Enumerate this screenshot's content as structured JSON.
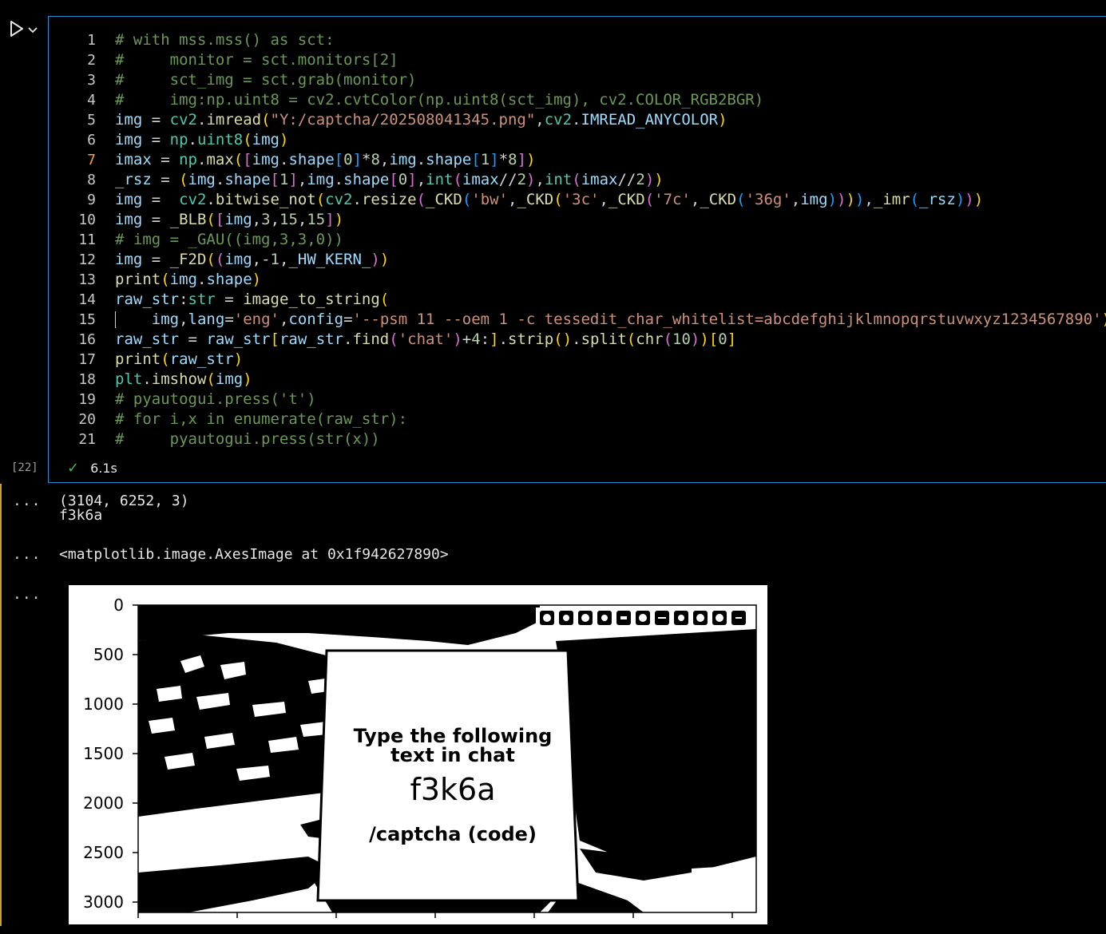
{
  "cell": {
    "exec_count": "[22]",
    "status_time": "6.1s",
    "icons": {
      "run": "play-icon",
      "run_menu": "chevron-down-icon",
      "status": "check-icon"
    }
  },
  "code_lines": [
    {
      "n": "1",
      "tokens": [
        [
          "cm",
          "# with mss.mss() as sct:"
        ]
      ]
    },
    {
      "n": "2",
      "tokens": [
        [
          "cm",
          "#     monitor = sct.monitors[2]"
        ]
      ]
    },
    {
      "n": "3",
      "tokens": [
        [
          "cm",
          "#     sct_img = sct.grab(monitor)"
        ]
      ]
    },
    {
      "n": "4",
      "tokens": [
        [
          "cm",
          "#     img:np.uint8 = cv2.cvtColor(np.uint8(sct_img), cv2.COLOR_RGB2BGR)"
        ]
      ]
    },
    {
      "n": "5",
      "tokens": [
        [
          "vr",
          "img"
        ],
        [
          "op",
          " = "
        ],
        [
          "bi",
          "cv2"
        ],
        [
          "op",
          "."
        ],
        [
          "fn",
          "imread"
        ],
        [
          "p1",
          "("
        ],
        [
          "st",
          "\"Y:/captcha/202508041345.png\""
        ],
        [
          "op",
          ","
        ],
        [
          "bi",
          "cv2"
        ],
        [
          "op",
          "."
        ],
        [
          "vr",
          "IMREAD_ANYCOLOR"
        ],
        [
          "p1",
          ")"
        ]
      ]
    },
    {
      "n": "6",
      "tokens": [
        [
          "vr",
          "img"
        ],
        [
          "op",
          " = "
        ],
        [
          "bi",
          "np"
        ],
        [
          "op",
          "."
        ],
        [
          "bi",
          "uint8"
        ],
        [
          "p1",
          "("
        ],
        [
          "vr",
          "img"
        ],
        [
          "p1",
          ")"
        ]
      ]
    },
    {
      "n": "7",
      "active": true,
      "tokens": [
        [
          "vr",
          "imax"
        ],
        [
          "op",
          " = "
        ],
        [
          "bi",
          "np"
        ],
        [
          "op",
          "."
        ],
        [
          "fn",
          "max"
        ],
        [
          "p1",
          "("
        ],
        [
          "p2",
          "["
        ],
        [
          "vr",
          "img"
        ],
        [
          "op",
          "."
        ],
        [
          "vr",
          "shape"
        ],
        [
          "p3",
          "["
        ],
        [
          "nm",
          "0"
        ],
        [
          "p3",
          "]"
        ],
        [
          "op",
          "*"
        ],
        [
          "nm",
          "8"
        ],
        [
          "op",
          ","
        ],
        [
          "vr",
          "img"
        ],
        [
          "op",
          "."
        ],
        [
          "vr",
          "shape"
        ],
        [
          "p3",
          "["
        ],
        [
          "nm",
          "1"
        ],
        [
          "p3",
          "]"
        ],
        [
          "op",
          "*"
        ],
        [
          "nm",
          "8"
        ],
        [
          "p2",
          "]"
        ],
        [
          "p1",
          ")"
        ]
      ]
    },
    {
      "n": "8",
      "tokens": [
        [
          "vr",
          "_rsz"
        ],
        [
          "op",
          " = "
        ],
        [
          "p1",
          "("
        ],
        [
          "vr",
          "img"
        ],
        [
          "op",
          "."
        ],
        [
          "vr",
          "shape"
        ],
        [
          "p2",
          "["
        ],
        [
          "nm",
          "1"
        ],
        [
          "p2",
          "]"
        ],
        [
          "op",
          ","
        ],
        [
          "vr",
          "img"
        ],
        [
          "op",
          "."
        ],
        [
          "vr",
          "shape"
        ],
        [
          "p2",
          "["
        ],
        [
          "nm",
          "0"
        ],
        [
          "p2",
          "]"
        ],
        [
          "op",
          ","
        ],
        [
          "bi",
          "int"
        ],
        [
          "p2",
          "("
        ],
        [
          "vr",
          "imax"
        ],
        [
          "op",
          "//"
        ],
        [
          "nm",
          "2"
        ],
        [
          "p2",
          ")"
        ],
        [
          "op",
          ","
        ],
        [
          "bi",
          "int"
        ],
        [
          "p2",
          "("
        ],
        [
          "vr",
          "imax"
        ],
        [
          "op",
          "//"
        ],
        [
          "nm",
          "2"
        ],
        [
          "p2",
          ")"
        ],
        [
          "p1",
          ")"
        ]
      ]
    },
    {
      "n": "9",
      "tokens": [
        [
          "vr",
          "img"
        ],
        [
          "op",
          " =  "
        ],
        [
          "bi",
          "cv2"
        ],
        [
          "op",
          "."
        ],
        [
          "fn",
          "bitwise_not"
        ],
        [
          "p1",
          "("
        ],
        [
          "bi",
          "cv2"
        ],
        [
          "op",
          "."
        ],
        [
          "fn",
          "resize"
        ],
        [
          "p2",
          "("
        ],
        [
          "fn",
          "_CKD"
        ],
        [
          "p3",
          "("
        ],
        [
          "st",
          "'bw'"
        ],
        [
          "op",
          ","
        ],
        [
          "fn",
          "_CKD"
        ],
        [
          "p1",
          "("
        ],
        [
          "st",
          "'3c'"
        ],
        [
          "op",
          ","
        ],
        [
          "fn",
          "_CKD"
        ],
        [
          "p2",
          "("
        ],
        [
          "st",
          "'7c'"
        ],
        [
          "op",
          ","
        ],
        [
          "fn",
          "_CKD"
        ],
        [
          "p3",
          "("
        ],
        [
          "st",
          "'36g'"
        ],
        [
          "op",
          ","
        ],
        [
          "vr",
          "img"
        ],
        [
          "p3",
          ")"
        ],
        [
          "p2",
          ")"
        ],
        [
          "p1",
          ")"
        ],
        [
          "p3",
          ")"
        ],
        [
          "op",
          ","
        ],
        [
          "fn",
          "_imr"
        ],
        [
          "p3",
          "("
        ],
        [
          "vr",
          "_rsz"
        ],
        [
          "p3",
          ")"
        ],
        [
          "p2",
          ")"
        ],
        [
          "p1",
          ")"
        ]
      ]
    },
    {
      "n": "10",
      "tokens": [
        [
          "vr",
          "img"
        ],
        [
          "op",
          " = "
        ],
        [
          "fn",
          "_BLB"
        ],
        [
          "p1",
          "("
        ],
        [
          "p2",
          "["
        ],
        [
          "vr",
          "img"
        ],
        [
          "op",
          ","
        ],
        [
          "nm",
          "3"
        ],
        [
          "op",
          ","
        ],
        [
          "nm",
          "15"
        ],
        [
          "op",
          ","
        ],
        [
          "nm",
          "15"
        ],
        [
          "p2",
          "]"
        ],
        [
          "p1",
          ")"
        ]
      ]
    },
    {
      "n": "11",
      "tokens": [
        [
          "cm",
          "# img = _GAU((img,3,3,0))"
        ]
      ]
    },
    {
      "n": "12",
      "tokens": [
        [
          "vr",
          "img"
        ],
        [
          "op",
          " = "
        ],
        [
          "fn",
          "_F2D"
        ],
        [
          "p1",
          "("
        ],
        [
          "p2",
          "("
        ],
        [
          "vr",
          "img"
        ],
        [
          "op",
          ",-"
        ],
        [
          "nm",
          "1"
        ],
        [
          "op",
          ","
        ],
        [
          "vr",
          "_HW_KERN_"
        ],
        [
          "p2",
          ")"
        ],
        [
          "p1",
          ")"
        ]
      ]
    },
    {
      "n": "13",
      "tokens": [
        [
          "fn",
          "print"
        ],
        [
          "p1",
          "("
        ],
        [
          "vr",
          "img"
        ],
        [
          "op",
          "."
        ],
        [
          "vr",
          "shape"
        ],
        [
          "p1",
          ")"
        ]
      ]
    },
    {
      "n": "14",
      "tokens": [
        [
          "vr",
          "raw_str"
        ],
        [
          "op",
          ":"
        ],
        [
          "bi",
          "str"
        ],
        [
          "op",
          " = "
        ],
        [
          "fn",
          "image_to_string"
        ],
        [
          "p1",
          "("
        ]
      ]
    },
    {
      "n": "15",
      "guide": true,
      "tokens": [
        [
          "op",
          "    "
        ],
        [
          "vr",
          "img"
        ],
        [
          "op",
          ","
        ],
        [
          "vr",
          "lang"
        ],
        [
          "op",
          "="
        ],
        [
          "st",
          "'eng'"
        ],
        [
          "op",
          ","
        ],
        [
          "vr",
          "config"
        ],
        [
          "op",
          "="
        ],
        [
          "st",
          "'--psm 11 --oem 1 -c tessedit_char_whitelist=abcdefghijklmnopqrstuvwxyz1234567890'"
        ],
        [
          "p1",
          ")"
        ]
      ]
    },
    {
      "n": "16",
      "tokens": [
        [
          "vr",
          "raw_str"
        ],
        [
          "op",
          " = "
        ],
        [
          "vr",
          "raw_str"
        ],
        [
          "p1",
          "["
        ],
        [
          "vr",
          "raw_str"
        ],
        [
          "op",
          "."
        ],
        [
          "fn",
          "find"
        ],
        [
          "p2",
          "("
        ],
        [
          "st",
          "'chat'"
        ],
        [
          "p2",
          ")"
        ],
        [
          "op",
          "+"
        ],
        [
          "nm",
          "4"
        ],
        [
          "op",
          ":"
        ],
        [
          "p1",
          "]"
        ],
        [
          "op",
          "."
        ],
        [
          "fn",
          "strip"
        ],
        [
          "p1",
          "()"
        ],
        [
          "op",
          "."
        ],
        [
          "fn",
          "split"
        ],
        [
          "p1",
          "("
        ],
        [
          "fn",
          "chr"
        ],
        [
          "p2",
          "("
        ],
        [
          "nm",
          "10"
        ],
        [
          "p2",
          ")"
        ],
        [
          "p1",
          ")"
        ],
        [
          "p1",
          "["
        ],
        [
          "nm",
          "0"
        ],
        [
          "p1",
          "]"
        ]
      ]
    },
    {
      "n": "17",
      "tokens": [
        [
          "fn",
          "print"
        ],
        [
          "p1",
          "("
        ],
        [
          "vr",
          "raw_str"
        ],
        [
          "p1",
          ")"
        ]
      ]
    },
    {
      "n": "18",
      "tokens": [
        [
          "bi",
          "plt"
        ],
        [
          "op",
          "."
        ],
        [
          "fn",
          "imshow"
        ],
        [
          "p1",
          "("
        ],
        [
          "vr",
          "img"
        ],
        [
          "p1",
          ")"
        ]
      ]
    },
    {
      "n": "19",
      "tokens": [
        [
          "cm",
          "# pyautogui.press('t')"
        ]
      ]
    },
    {
      "n": "20",
      "tokens": [
        [
          "cm",
          "# for i,x in enumerate(raw_str):"
        ]
      ]
    },
    {
      "n": "21",
      "tokens": [
        [
          "cm",
          "#     pyautogui.press(str(x))"
        ]
      ]
    }
  ],
  "outputs": {
    "ellipsis": "...",
    "stream_line1": "(3104, 6252, 3)",
    "stream_line2": "f3k6a",
    "repr": "<matplotlib.image.AxesImage at 0x1f942627890>"
  },
  "figure": {
    "y_ticks": [
      "0",
      "500",
      "1000",
      "1500",
      "2000",
      "2500",
      "3000"
    ],
    "sign_line1": "Type the following",
    "sign_line2": "text in chat",
    "sign_code": "f3k6a",
    "sign_command": "/captcha (code)"
  }
}
